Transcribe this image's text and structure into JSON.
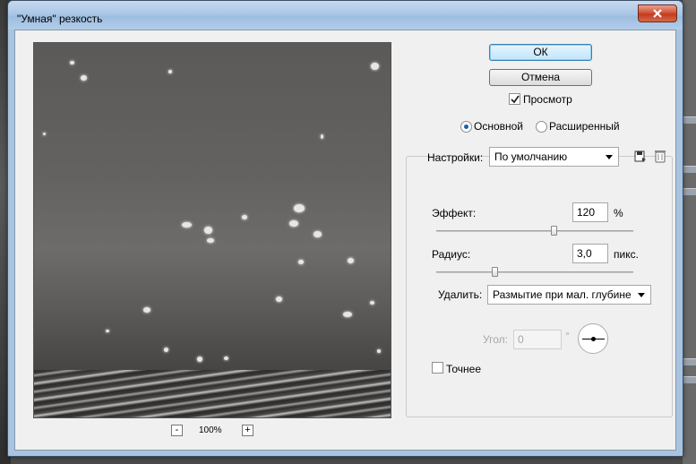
{
  "window": {
    "title": "\"Умная\" резкость"
  },
  "preview": {
    "zoom_minus": "-",
    "zoom_plus": "+",
    "zoom_value": "100%"
  },
  "buttons": {
    "ok": "ОК",
    "cancel": "Отмена"
  },
  "preview_checkbox": {
    "label": "Просмотр",
    "checked": true
  },
  "mode": {
    "basic": "Основной",
    "advanced": "Расширенный",
    "selected": "basic"
  },
  "settings": {
    "label": "Настройки:",
    "value": "По умолчанию"
  },
  "effect": {
    "label": "Эффект:",
    "value": "120",
    "unit": "%",
    "slider_fraction": 0.6
  },
  "radius": {
    "label": "Радиус:",
    "value": "3,0",
    "unit": "пикс.",
    "slider_fraction": 0.3
  },
  "remove": {
    "label": "Удалить:",
    "value": "Размытие при мал. глубине"
  },
  "angle": {
    "label": "Угол:",
    "value": "0",
    "unit": "°"
  },
  "precise": {
    "label": "Точнее",
    "checked": false
  },
  "colors": {
    "accent": "#3c7fb1",
    "close": "#c23a1c",
    "title_bar": "#aac7e6"
  }
}
